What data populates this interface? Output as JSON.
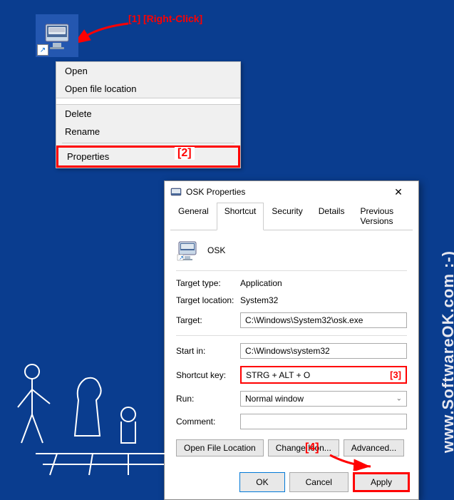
{
  "annotations": {
    "step1": "[1] [Right-Click]",
    "step2": "[2]",
    "step3": "[3]",
    "step4": "[4]"
  },
  "context_menu": {
    "items": [
      "Open",
      "Open file location",
      "Delete",
      "Rename",
      "Properties"
    ]
  },
  "dialog": {
    "title": "OSK Properties",
    "close": "✕",
    "tabs": [
      "General",
      "Shortcut",
      "Security",
      "Details",
      "Previous Versions"
    ],
    "icon_label": "OSK",
    "fields": {
      "target_type_label": "Target type:",
      "target_type_value": "Application",
      "target_location_label": "Target location:",
      "target_location_value": "System32",
      "target_label": "Target:",
      "target_value": "C:\\Windows\\System32\\osk.exe",
      "start_in_label": "Start in:",
      "start_in_value": "C:\\Windows\\system32",
      "shortcut_key_label": "Shortcut key:",
      "shortcut_key_value": "STRG + ALT + O",
      "run_label": "Run:",
      "run_value": "Normal window",
      "comment_label": "Comment:",
      "comment_value": ""
    },
    "buttons": {
      "open_file_location": "Open File Location",
      "change_icon": "Change Icon...",
      "advanced": "Advanced...",
      "ok": "OK",
      "cancel": "Cancel",
      "apply": "Apply"
    }
  },
  "watermark": "www.SoftwareOK.com :-)"
}
